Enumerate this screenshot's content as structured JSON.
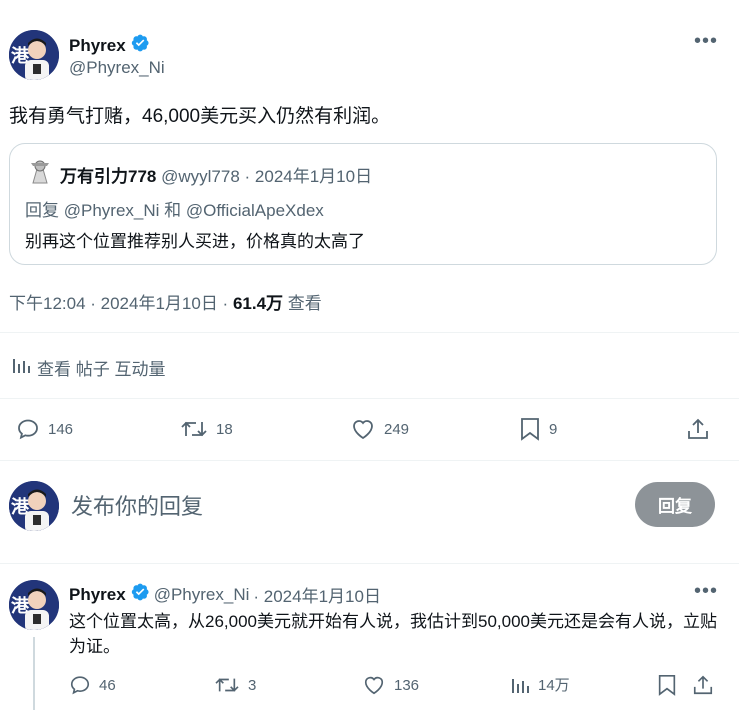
{
  "post": {
    "author_name": "Phyrex",
    "author_handle": "@Phyrex_Ni",
    "text": "我有勇气打赌，46,000美元买入仍然有利润。",
    "timestamp": "下午12:04 · 2024年1月10日 · ",
    "views_count": "61.4万",
    "views_label": " 查看",
    "engagement_link": "查看 帖子 互动量"
  },
  "quote": {
    "author_name": "万有引力778",
    "author_handle": "@wyyl778",
    "date": " · 2024年1月10日",
    "reply_prefix": "回复 ",
    "reply_to_1": "@Phyrex_Ni",
    "reply_and": " 和 ",
    "reply_to_2": "@OfficialApeXdex",
    "text": "别再这个位置推荐别人买进，价格真的太高了"
  },
  "actions": {
    "replies": "146",
    "reposts": "18",
    "likes": "249",
    "bookmarks": "9"
  },
  "composer": {
    "placeholder": "发布你的回复",
    "button_label": "回复"
  },
  "reply": {
    "author_name": "Phyrex",
    "author_handle": "@Phyrex_Ni",
    "date": " · 2024年1月10日",
    "text": "这个位置太高，从26,000美元就开始有人说，我估计到50,000美元还是会有人说，立贴为证。",
    "replies": "46",
    "reposts": "3",
    "likes": "136",
    "views": "14万"
  },
  "colors": {
    "verified": "#1d9bf0",
    "reply_button": "#8d9398",
    "muted_text": "#536471",
    "border": "#cfd9de"
  }
}
